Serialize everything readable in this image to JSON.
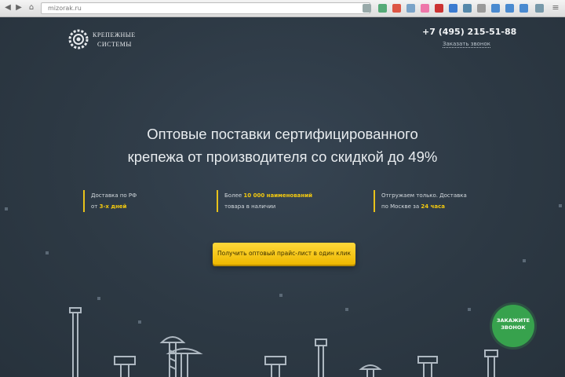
{
  "browser": {
    "url": "mizorak.ru"
  },
  "header": {
    "logo_line1": "КРЕПЕЖНЫЕ",
    "logo_line2": "СИСТЕМЫ",
    "phone": "+7 (495) 215-51-88",
    "callback_link": "Заказать звонок"
  },
  "hero": {
    "headline_line1": "Оптовые поставки сертифицированного",
    "headline_line2": "крепежа от производителя со скидкой до 49%"
  },
  "features": [
    {
      "line1_pre": "Доставка по РФ",
      "line1_hl": "",
      "line2_pre": "от ",
      "line2_hl": "3-х дней"
    },
    {
      "line1_pre": "Более ",
      "line1_hl": "10 000 наименований",
      "line2_pre": "товара в наличии",
      "line2_hl": ""
    },
    {
      "line1_pre": "Отгружаем только. Доставка",
      "line1_hl": "",
      "line2_pre": "по Москве за ",
      "line2_hl": "24 часа"
    }
  ],
  "cta": {
    "label": "Получить оптовый прайс-лист в один клик"
  },
  "badge": {
    "line1": "ЗАКАЖИТЕ",
    "line2": "ЗВОНОК"
  },
  "colors": {
    "accent": "#f3c90f",
    "background": "#2e3a45",
    "badge": "#37a24d"
  }
}
